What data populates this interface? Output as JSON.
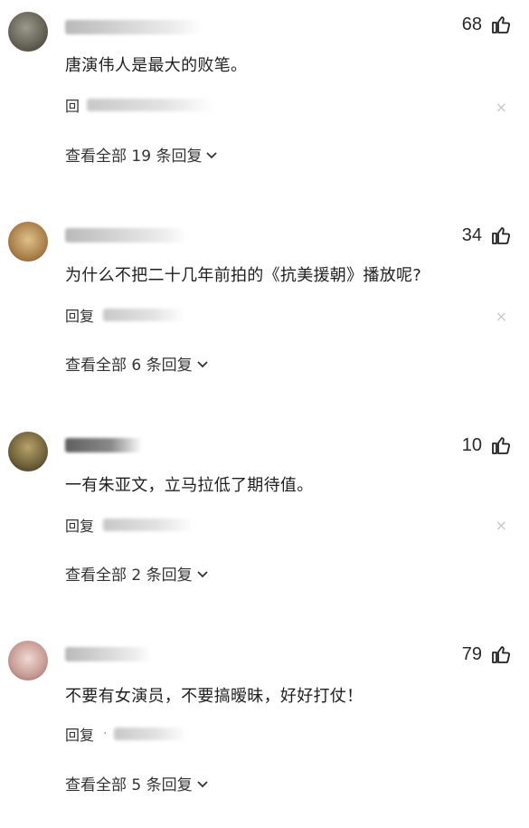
{
  "comments": [
    {
      "likes": "68",
      "text": "唐演伟人是最大的败笔。",
      "reply_label": "回",
      "view_replies": "查看全部 19 条回复",
      "colors": [
        "#7a7a6e",
        "#4f4a42"
      ]
    },
    {
      "likes": "34",
      "text": "为什么不把二十几年前拍的《抗美援朝》播放呢?",
      "reply_label": "回复",
      "view_replies": "查看全部 6 条回复",
      "colors": [
        "#c9a36b",
        "#7c5a36"
      ]
    },
    {
      "likes": "10",
      "text": "一有朱亚文，立马拉低了期待值。",
      "reply_label": "回复",
      "view_replies": "查看全部 2 条回复",
      "colors": [
        "#8b7a4a",
        "#3e3a28"
      ]
    },
    {
      "likes": "79",
      "text": "不要有女演员，不要搞暧昧，好好打仗！",
      "reply_label": "回复",
      "reply_dot": "·",
      "view_replies": "查看全部 5 条回复",
      "colors": [
        "#d9b9b5",
        "#8e5e5a"
      ]
    }
  ],
  "icons": {
    "like": "thumbs-up-icon",
    "close": "close-icon",
    "chevron": "chevron-down-icon",
    "close_glyph": "×"
  }
}
